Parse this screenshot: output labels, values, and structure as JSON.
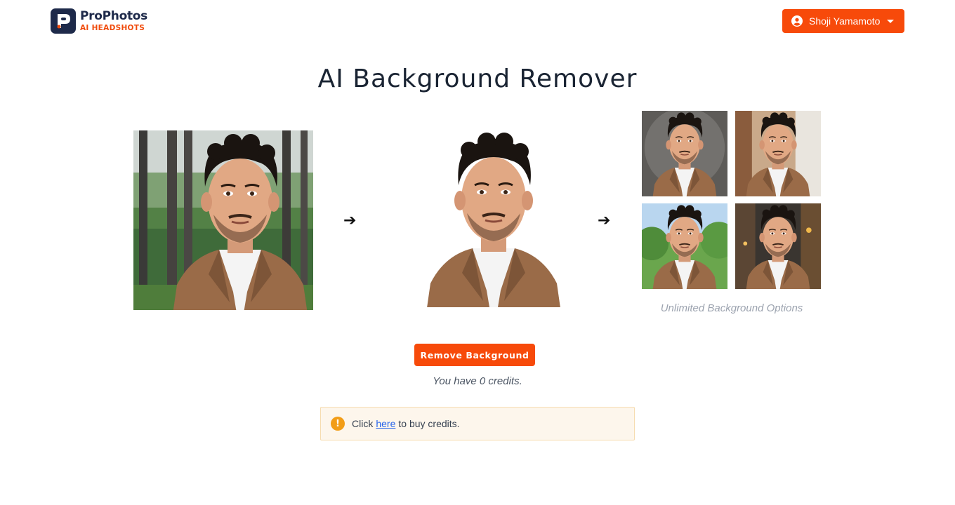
{
  "header": {
    "brand_name": "ProPhotos",
    "brand_sub": "AI HEADSHOTS",
    "user_name": "Shoji Yamamoto",
    "icons": {
      "avatar": "user-circle-icon",
      "dropdown": "caret-down-icon",
      "logo": "p-logo-icon"
    }
  },
  "main": {
    "title": "AI Background Remover",
    "arrow_glyph": "➔",
    "options_caption": "Unlimited Background Options",
    "remove_button_label": "Remove Background",
    "credits_text": "You have 0 credits.",
    "alert": {
      "prefix": "Click",
      "link": "here",
      "suffix": "to buy credits."
    }
  },
  "colors": {
    "accent": "#f74a0a",
    "brand_navy": "#1e2a4a",
    "alert_bg": "#fdf6ec",
    "alert_icon": "#f29d17"
  }
}
